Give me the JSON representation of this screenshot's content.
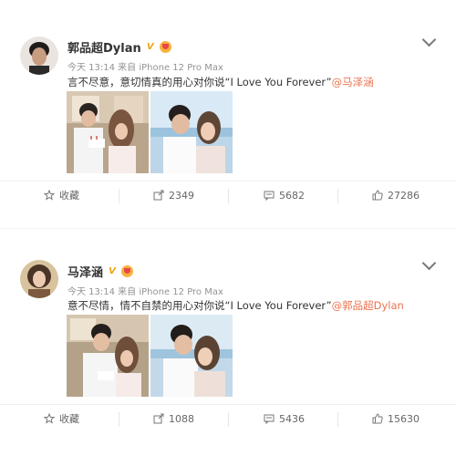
{
  "posts": [
    {
      "username": "郭品超Dylan",
      "v_badge": "V",
      "meta": "今天 13:14 来自 iPhone 12 Pro Max",
      "text_prefix": "言不尽意，意切情真的用心对你说“I Love You Forever”",
      "mention": "@马泽涵",
      "actions": {
        "favorite": "收藏",
        "repost": "2349",
        "comment": "5682",
        "like": "27286"
      }
    },
    {
      "username": "马泽涵",
      "v_badge": "V",
      "meta": "今天 13:14 来自 iPhone 12 Pro Max",
      "text_prefix": "意不尽情，情不自禁的用心对你说“I Love You Forever”",
      "mention": "@郭品超Dylan",
      "actions": {
        "favorite": "收藏",
        "repost": "1088",
        "comment": "5436",
        "like": "15630"
      }
    }
  ],
  "colors": {
    "mention": "#eb7350",
    "meta_gray": "#939393",
    "v_badge": "#f0a312"
  },
  "icons": [
    "star-icon",
    "share-icon",
    "comment-icon",
    "thumb-up-icon",
    "chevron-down-icon",
    "vip-crown-icon"
  ]
}
